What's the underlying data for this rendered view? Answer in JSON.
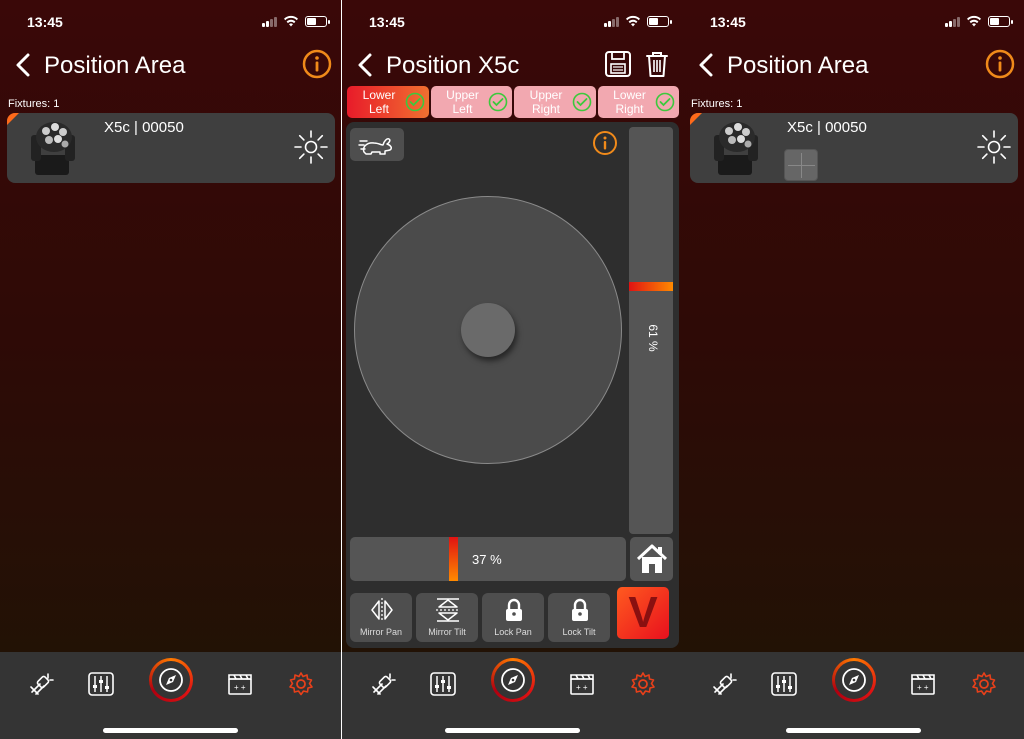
{
  "status": {
    "time": "13:45"
  },
  "screen_area": {
    "title": "Position Area",
    "fixtures_count": "Fixtures: 1",
    "fixture": {
      "name": "X5c | 00050"
    }
  },
  "screen_position": {
    "title": "Position X5c",
    "presets": [
      {
        "label": "Lower Left",
        "active": true,
        "checked": true
      },
      {
        "label": "Upper Left",
        "active": false,
        "checked": true
      },
      {
        "label": "Upper Right",
        "active": false,
        "checked": true
      },
      {
        "label": "Lower Right",
        "active": false,
        "checked": true
      }
    ],
    "tilt": {
      "value_label": "61 %",
      "level": 0.61
    },
    "pan": {
      "value_label": "37 %",
      "level": 0.37
    },
    "controls": [
      {
        "label": "Mirror Pan",
        "icon": "mirror-pan-icon"
      },
      {
        "label": "Mirror Tilt",
        "icon": "mirror-tilt-icon"
      },
      {
        "label": "Lock Pan",
        "icon": "lock-icon"
      },
      {
        "label": "Lock Tilt",
        "icon": "lock-icon"
      }
    ],
    "logo_letter": "V"
  },
  "tabbar": {
    "tabs": [
      "fixtures-icon",
      "mixer-icon",
      "compass-icon",
      "scenes-icon",
      "settings-icon"
    ],
    "active": "compass-icon",
    "accent": "#e8401a"
  },
  "colors": {
    "preset_active": "#e81b2a",
    "preset_inactive": "#f2a8b0",
    "info": "#f08a1a",
    "check": "#3cc93c"
  }
}
